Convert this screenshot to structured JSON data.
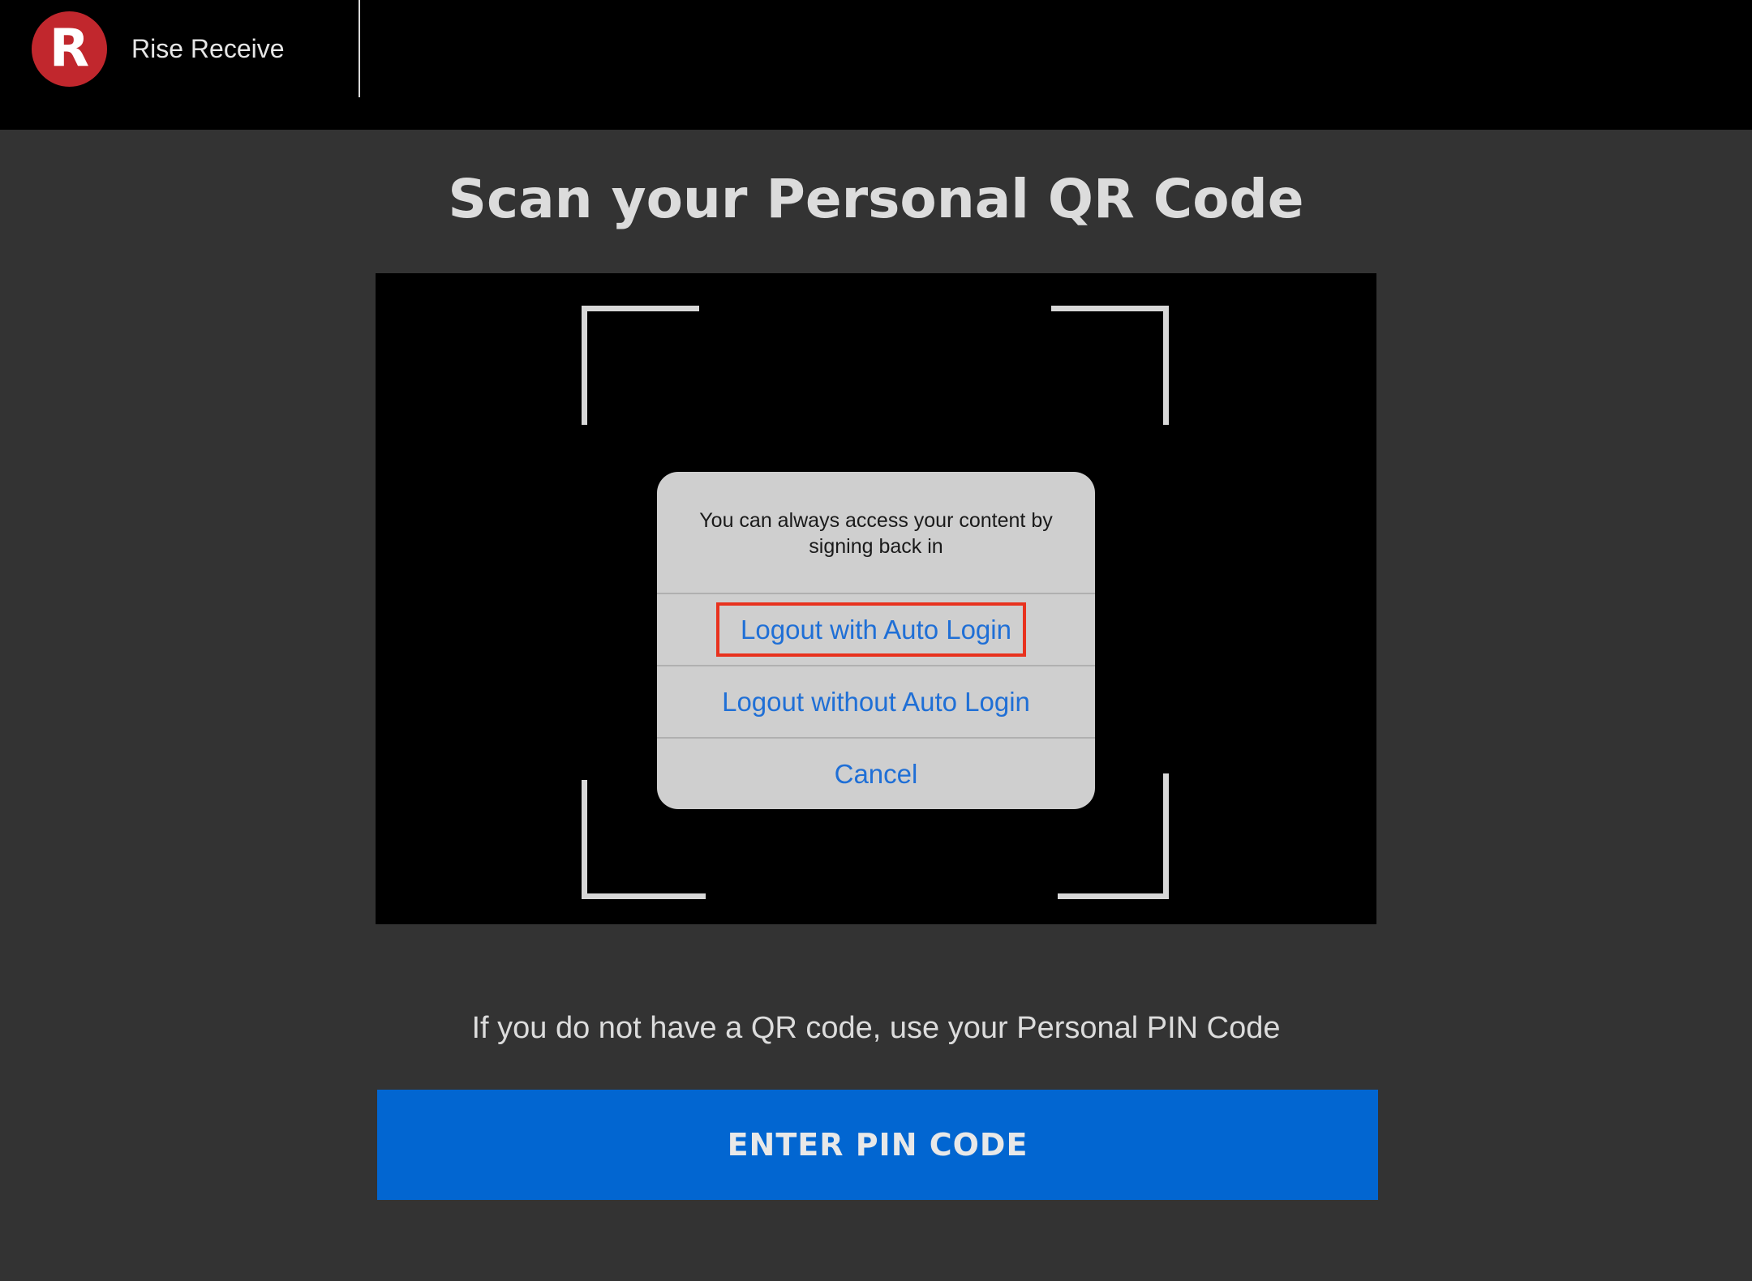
{
  "header": {
    "logo_letter": "R",
    "app_name": "Rise Receive"
  },
  "main": {
    "title": "Scan your Personal QR Code",
    "pin_hint": "If you do not have a QR code, use your Personal PIN Code",
    "pin_button_label": "ENTER PIN CODE"
  },
  "alert": {
    "message": "You can always access your content by signing back in",
    "actions": [
      "Logout with Auto Login",
      "Logout without Auto Login",
      "Cancel"
    ]
  },
  "colors": {
    "brand_red": "#c1272d",
    "action_blue": "#1f6fd6",
    "button_blue": "#0266d1",
    "highlight_red": "#e8321e"
  }
}
